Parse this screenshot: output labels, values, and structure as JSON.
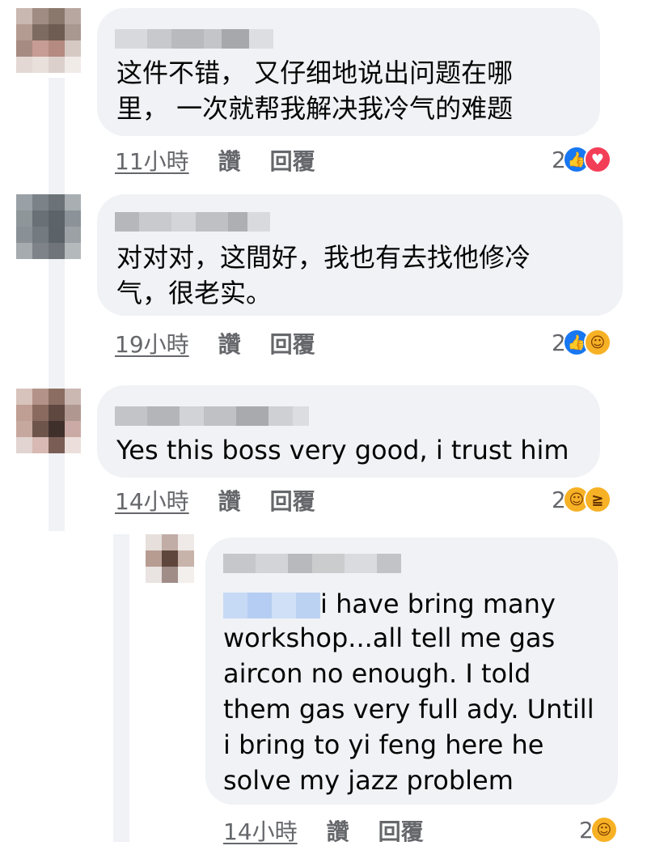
{
  "comments": [
    {
      "text": "这件不错， 又仔细地说出问题在哪\n里， 一次就帮我解决我冷气的难题",
      "time": "11小時",
      "like": "讚",
      "reply": "回覆",
      "reaction_count": "2",
      "reactions": [
        "like-icon",
        "love-icon"
      ]
    },
    {
      "text": "对对对，这間好，我也有去找他修冷\n气，很老实。",
      "time": "19小時",
      "like": "讚",
      "reply": "回覆",
      "reaction_count": "2",
      "reactions": [
        "like-icon",
        "care-icon"
      ]
    },
    {
      "text": "Yes this boss very good, i trust him",
      "time": "14小時",
      "like": "讚",
      "reply": "回覆",
      "reaction_count": "2",
      "reactions": [
        "care-icon",
        "haha-icon"
      ]
    }
  ],
  "reply": {
    "text_first": "i have bring many",
    "text_rest": "workshop...all tell me gas\naircon no enough. I told\nthem gas very full ady. Untill\ni bring to yi feng here he\nsolve my jazz problem",
    "time": "14小時",
    "like": "讚",
    "reply": "回覆",
    "reaction_count": "2",
    "reactions": [
      "care-icon"
    ]
  },
  "colors": {
    "bubble": "#f0f2f5",
    "meta_text": "#65676b",
    "like_blue": "#1877f2",
    "love_red": "#f33e58",
    "emoji_yellow": "#f7b125"
  }
}
